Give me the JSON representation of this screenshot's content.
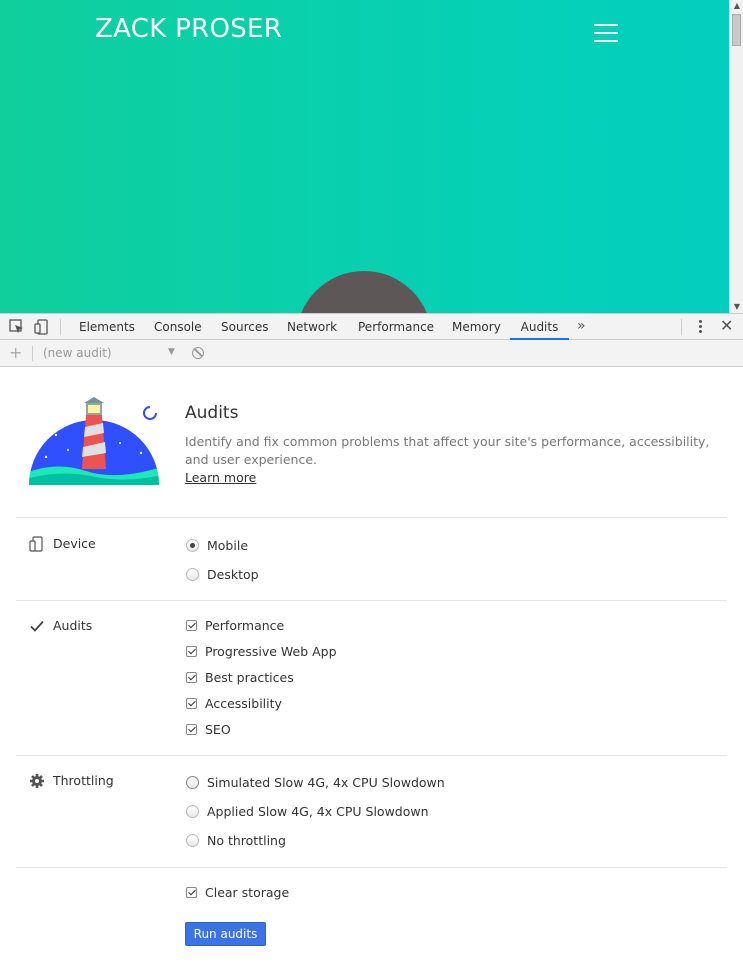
{
  "site": {
    "logo": "ZACK PROSER",
    "colors": {
      "gradient_start": "#10cf9c",
      "gradient_end": "#03cfc0"
    }
  },
  "devtools": {
    "tabs": [
      {
        "label": "Elements",
        "active": false
      },
      {
        "label": "Console",
        "active": false
      },
      {
        "label": "Sources",
        "active": false
      },
      {
        "label": "Network",
        "active": false
      },
      {
        "label": "Performance",
        "active": false
      },
      {
        "label": "Memory",
        "active": false
      },
      {
        "label": "Audits",
        "active": true
      }
    ],
    "more_label": "»",
    "close_label": "✕"
  },
  "audit_toolbar": {
    "add_label": "+",
    "selected_audit": "(new audit)"
  },
  "panel": {
    "title": "Audits",
    "description": "Identify and fix common problems that affect your site's performance, accessibility, and user experience.",
    "learn_more": "Learn more",
    "device": {
      "label": "Device",
      "options": [
        {
          "label": "Mobile",
          "selected": true
        },
        {
          "label": "Desktop",
          "selected": false
        }
      ]
    },
    "audits": {
      "label": "Audits",
      "options": [
        {
          "label": "Performance",
          "checked": true
        },
        {
          "label": "Progressive Web App",
          "checked": true
        },
        {
          "label": "Best practices",
          "checked": true
        },
        {
          "label": "Accessibility",
          "checked": true
        },
        {
          "label": "SEO",
          "checked": true
        }
      ]
    },
    "throttling": {
      "label": "Throttling",
      "options": [
        {
          "label": "Simulated Slow 4G, 4x CPU Slowdown",
          "selected": true
        },
        {
          "label": "Applied Slow 4G, 4x CPU Slowdown",
          "selected": false
        },
        {
          "label": "No throttling",
          "selected": false
        }
      ]
    },
    "clear_storage": {
      "label": "Clear storage",
      "checked": true
    },
    "run_button": "Run audits",
    "colors": {
      "accent": "#3b73e4",
      "tab_underline": "#1a73e8"
    }
  }
}
